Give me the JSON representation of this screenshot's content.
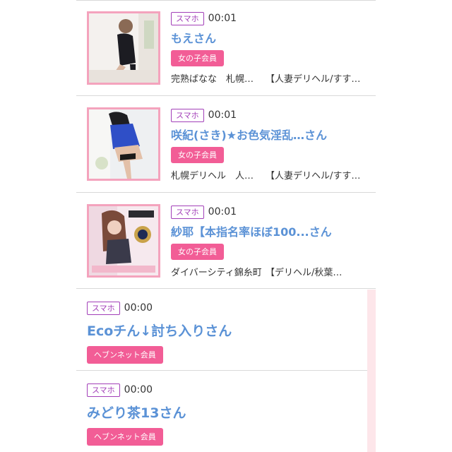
{
  "feed": {
    "items": [
      {
        "device_tag": "スマホ",
        "time": "00:01",
        "name": "もえさん",
        "member_badge": "女の子会員",
        "shop": "完熟ばなな　札幌…",
        "category": "【人妻デリヘル/すす…"
      },
      {
        "device_tag": "スマホ",
        "time": "00:01",
        "name": "咲紀(さき)★お色気淫乱…さん",
        "member_badge": "女の子会員",
        "shop": "札幌デリヘル　人…",
        "category": "【人妻デリヘル/すす…"
      },
      {
        "device_tag": "スマホ",
        "time": "00:01",
        "name": "紗耶【本指名率ほぼ100...さん",
        "member_badge": "女の子会員",
        "shop": "ダイバーシティ錦糸町蘭…",
        "category": "【デリヘル/秋葉…"
      },
      {
        "device_tag": "スマホ",
        "time": "00:00",
        "name": "Ecoチん↓討ち入りさん",
        "member_badge": "ヘブンネット会員"
      },
      {
        "device_tag": "スマホ",
        "time": "00:00",
        "name": "みどり茶13さん",
        "member_badge": "ヘブンネット会員"
      }
    ]
  },
  "colors": {
    "device_tag": "#a23fb8",
    "name": "#5b92d6",
    "badge_bg": "#f25d96",
    "thumb_border": "#f4a3bd"
  }
}
